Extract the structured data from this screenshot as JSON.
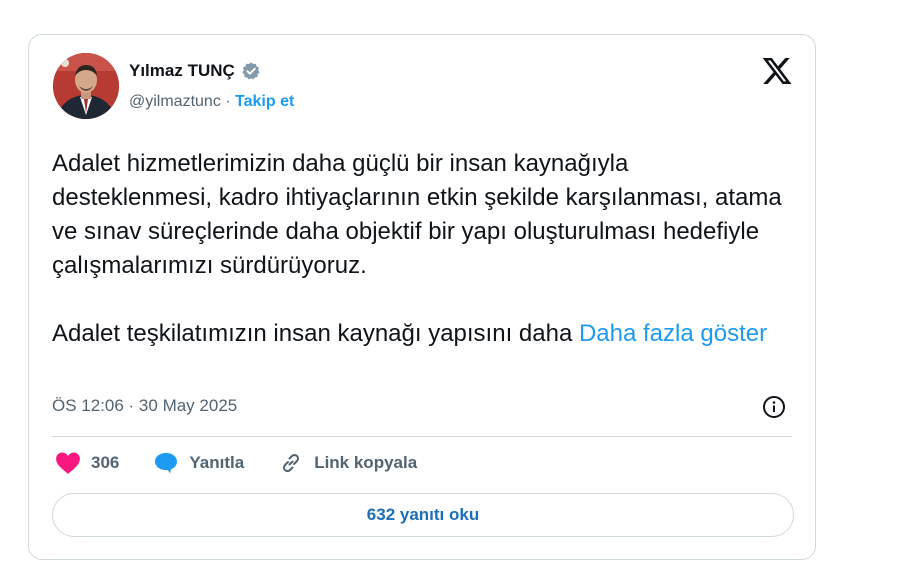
{
  "author": {
    "name": "Yılmaz TUNÇ",
    "handle": "@yilmaztunc",
    "separator": " · ",
    "follow_label": "Takip et"
  },
  "tweet": {
    "paragraph1": "Adalet hizmetlerimizin daha güçlü bir insan kaynağıyla desteklenmesi, kadro ihtiyaçlarının etkin şekilde karşılanması, atama ve sınav süreçlerinde daha objektif bir yapı oluşturulması hedefiyle çalışmalarımızı sürdürüyoruz.",
    "paragraph2": "Adalet teşkilatımızın insan kaynağı yapısını daha ",
    "show_more": "Daha fazla göster",
    "timestamp": "ÖS 12:06 · 30 May 2025"
  },
  "actions": {
    "like_count": "306",
    "reply_label": "Yanıtla",
    "copy_link_label": "Link kopyala"
  },
  "read_replies_label": "632 yanıtı oku",
  "icons": {
    "verified": "verified-badge-icon",
    "x_logo": "x-logo-icon",
    "info": "info-icon",
    "like": "heart-icon",
    "reply": "speech-bubble-icon",
    "link": "link-icon"
  },
  "colors": {
    "accent": "#1d9bf0",
    "like": "#f91880",
    "text": "#0f1419",
    "secondary": "#536471",
    "border": "#cfd9de"
  }
}
